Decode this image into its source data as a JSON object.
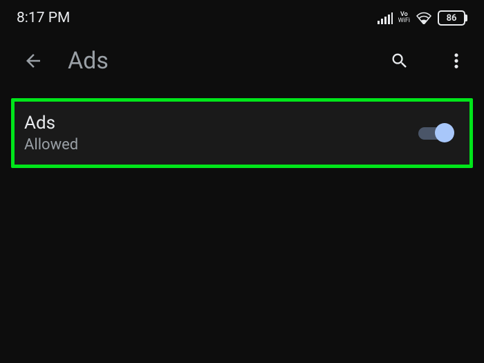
{
  "status_bar": {
    "time": "8:17 PM",
    "volte_top": "Vo",
    "volte_bottom": "WiFi",
    "battery_percent": "86"
  },
  "app_bar": {
    "title": "Ads"
  },
  "setting": {
    "title": "Ads",
    "subtitle": "Allowed",
    "toggle_on": true
  }
}
